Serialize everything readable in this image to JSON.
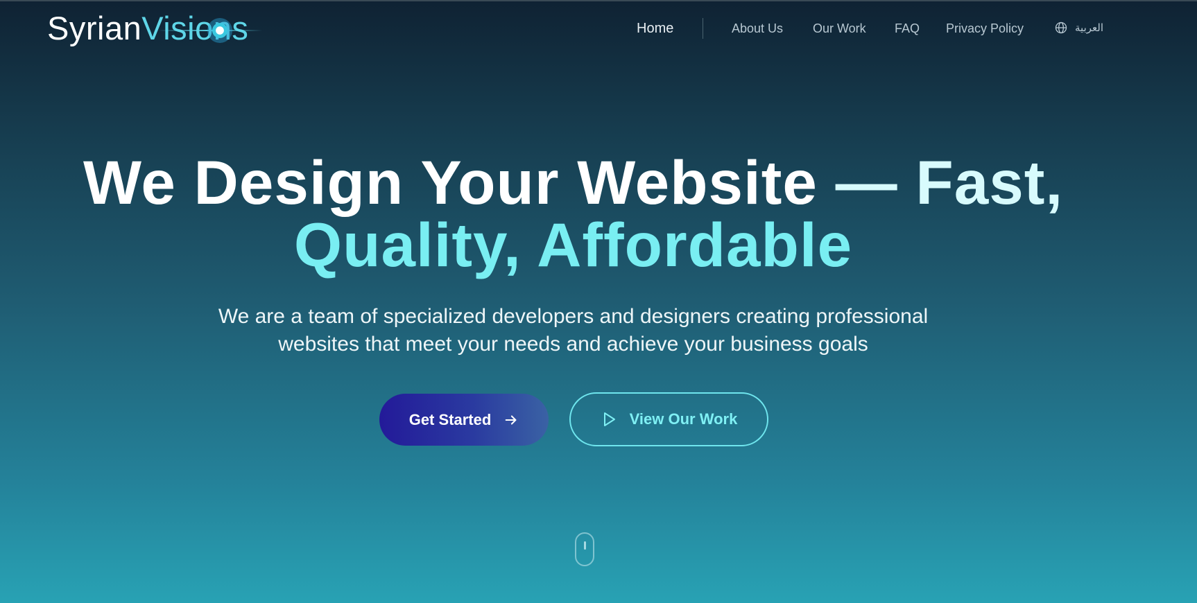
{
  "brand": {
    "name_part1": "Syrian",
    "name_part2": "Visions"
  },
  "nav": {
    "home": "Home",
    "about": "About Us",
    "work": "Our Work",
    "faq": "FAQ",
    "privacy": "Privacy Policy",
    "language": "العربية",
    "language_icon": "globe-icon"
  },
  "hero": {
    "title_line1_part1": "We Design Your Website",
    "title_line1_part2": "— Fast,",
    "title_line2": "Quality, Affordable",
    "subtitle_line1": "We are a team of specialized developers and designers creating professional",
    "subtitle_line2": "websites that meet your needs and achieve your business goals",
    "primary_button": "Get Started",
    "primary_button_icon": "arrow-right-icon",
    "secondary_button": "View Our Work",
    "secondary_button_icon": "play-icon",
    "scroll_indicator_icon": "mouse-scroll-icon"
  },
  "colors": {
    "accent_cyan": "#7ff0f4",
    "primary_button_start": "#231a99",
    "primary_button_end": "#3a62a4",
    "background_top": "#0f2233",
    "background_bottom": "#28a2b4"
  }
}
